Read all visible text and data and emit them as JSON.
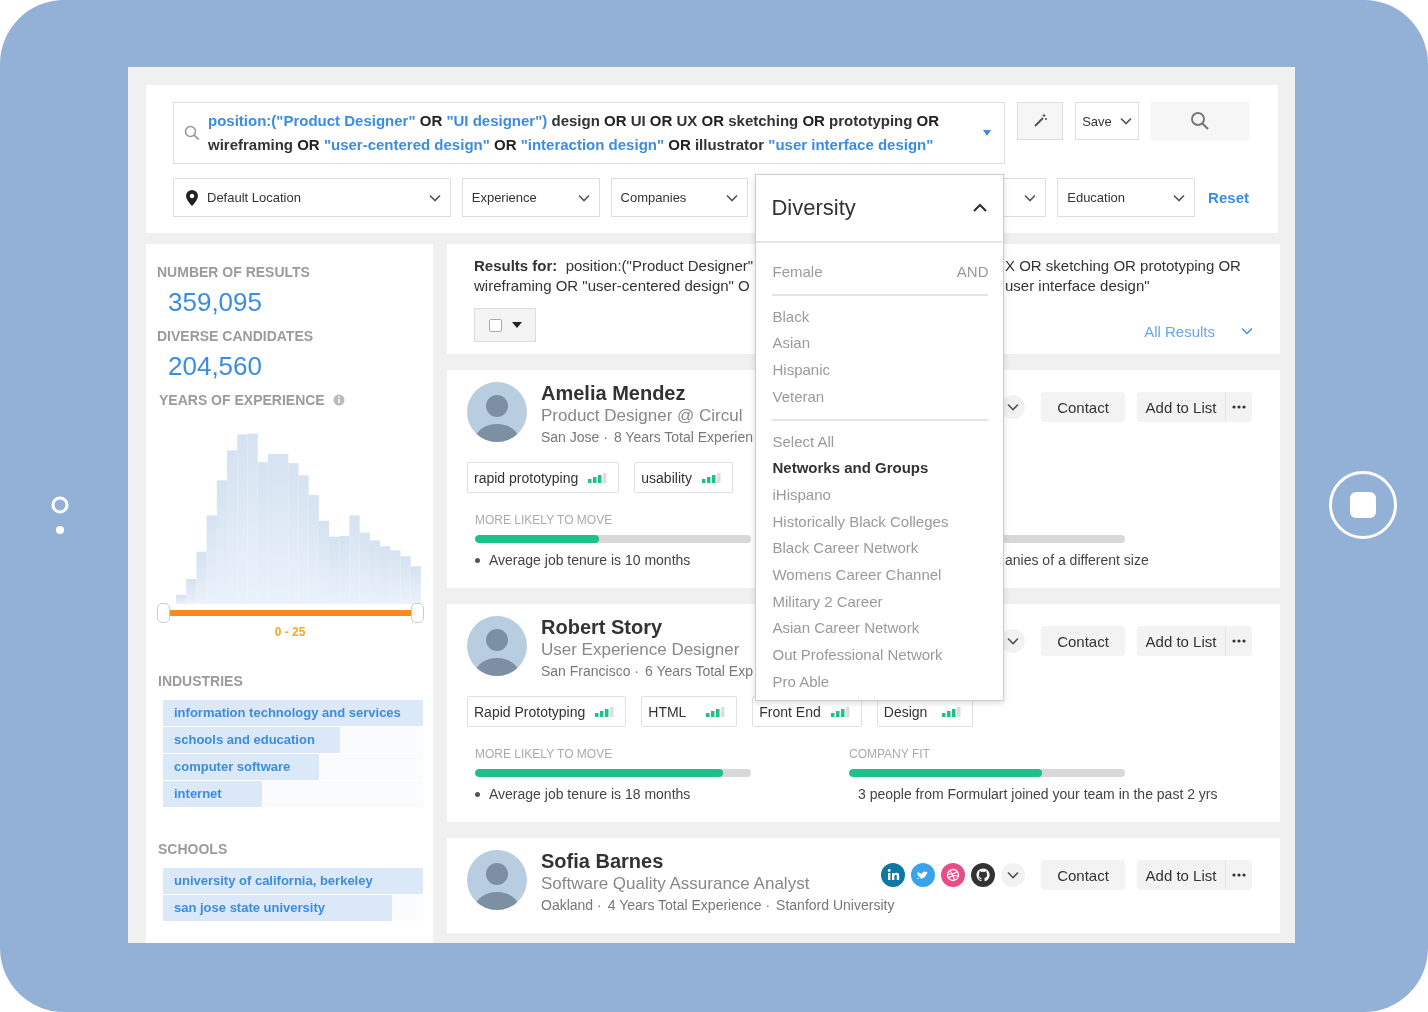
{
  "query": {
    "segments": [
      {
        "kind": "phrase",
        "text": "position:(\"Product Designer\""
      },
      {
        "kind": "op",
        "text": "OR"
      },
      {
        "kind": "phrase",
        "text": "\"UI designer\")"
      },
      {
        "kind": "word",
        "text": "design"
      },
      {
        "kind": "op",
        "text": "OR"
      },
      {
        "kind": "word",
        "text": "UI"
      },
      {
        "kind": "op",
        "text": "OR"
      },
      {
        "kind": "word",
        "text": "UX"
      },
      {
        "kind": "op",
        "text": "OR"
      },
      {
        "kind": "word",
        "text": "sketching"
      },
      {
        "kind": "op",
        "text": "OR"
      },
      {
        "kind": "word",
        "text": "prototyping"
      },
      {
        "kind": "op",
        "text": "OR"
      },
      {
        "kind": "word",
        "text": "wireframing"
      },
      {
        "kind": "op",
        "text": "OR"
      },
      {
        "kind": "phrase",
        "text": "\"user-centered design\""
      },
      {
        "kind": "op",
        "text": "OR"
      },
      {
        "kind": "phrase",
        "text": "\"interaction design\""
      },
      {
        "kind": "op",
        "text": "OR"
      },
      {
        "kind": "word",
        "text": "illustrator"
      },
      {
        "kind": "phrase",
        "text": "\"user interface design\""
      }
    ]
  },
  "save_button": "Save",
  "filters": [
    {
      "kind": "location",
      "label": "Default Location",
      "expanded": false
    },
    {
      "kind": "select",
      "label": "Experience",
      "expanded": false
    },
    {
      "kind": "select",
      "label": "Companies",
      "expanded": false
    },
    {
      "kind": "select",
      "label": "Diversity",
      "expanded": true
    },
    {
      "kind": "select",
      "expanded": false
    },
    {
      "kind": "select",
      "label": "Education",
      "expanded": false
    }
  ],
  "reset_link": "Reset",
  "diversity_menu": [
    {
      "kind": "option",
      "label": "Female",
      "suffix": "AND"
    },
    {
      "kind": "divider"
    },
    {
      "kind": "option",
      "label": "Black"
    },
    {
      "kind": "option",
      "label": "Asian"
    },
    {
      "kind": "option",
      "label": "Hispanic"
    },
    {
      "kind": "option",
      "label": "Veteran"
    },
    {
      "kind": "divider"
    },
    {
      "kind": "option",
      "label": "Select All"
    },
    {
      "kind": "heading",
      "label": "Networks and Groups"
    },
    {
      "kind": "option",
      "label": "iHispano"
    },
    {
      "kind": "option",
      "label": "Historically Black Colleges"
    },
    {
      "kind": "option",
      "label": "Black Career Network"
    },
    {
      "kind": "option",
      "label": "Womens Career Channel"
    },
    {
      "kind": "option",
      "label": "Military 2 Career"
    },
    {
      "kind": "option",
      "label": "Asian Career Network"
    },
    {
      "kind": "option",
      "label": "Out Professional Network"
    },
    {
      "kind": "option",
      "label": "Pro Able"
    }
  ],
  "stats": [
    {
      "label": "NUMBER OF RESULTS",
      "value": "359,095"
    },
    {
      "label": "DIVERSE CANDIDATES",
      "value": "204,560"
    }
  ],
  "experience": {
    "label": "YEARS OF EXPERIENCE",
    "level": 1,
    "range": "0 - 25"
  },
  "industries": {
    "title": "INDUSTRIES",
    "items": [
      {
        "label": "information technology and services",
        "level": 1
      },
      {
        "label": "schools and education",
        "level": 0.68
      },
      {
        "label": "computer software",
        "level": 0.6
      },
      {
        "label": "internet",
        "level": 0.38
      }
    ]
  },
  "schools": {
    "title": "SCHOOLS",
    "items": [
      {
        "label": "university of california, berkeley",
        "level": 1
      },
      {
        "label": "san jose state university",
        "level": 0.88
      }
    ]
  },
  "results": {
    "label": "Results for:",
    "checked": false,
    "left_lines": [
      "position:(\"Product Designer\"",
      "wireframing OR \"user-centered design\" O"
    ],
    "right_lines": [
      "X OR sketching OR prototyping OR",
      "user interface design\""
    ],
    "filter": "All Results"
  },
  "candidates": [
    {
      "name": "Amelia Mendez",
      "title": "Product Designer @ Circul",
      "meta": [
        "San Jose ·",
        "8 Years Total Experien"
      ],
      "contact": "Contact",
      "add": "Add to List",
      "skills": [
        "rapid prototyping",
        "usability"
      ],
      "metrics": [
        {
          "label": "MORE LIKELY TO MOVE",
          "level": 0.45,
          "note": "Average job tenure is 10 months"
        },
        {
          "kind": "cut",
          "note": "anies of a different size"
        }
      ]
    },
    {
      "name": "Robert Story",
      "title": "User Experience Designer",
      "meta": [
        "San Francisco ·",
        "6 Years Total Exp"
      ],
      "contact": "Contact",
      "add": "Add to List",
      "skills": [
        "Rapid Prototyping",
        "HTML",
        "Front End",
        "Design"
      ],
      "metrics": [
        {
          "label": "MORE LIKELY TO MOVE",
          "level": 0.9,
          "note": "Average job tenure is 18 months"
        },
        {
          "label": "COMPANY FIT",
          "level": 0.7,
          "note": "3 people from Formulart joined your team in the past 2 yrs"
        }
      ]
    },
    {
      "name": "Sofia Barnes",
      "title": "Software Quality Assurance Analyst",
      "meta": [
        "Oakland ·",
        "4 Years Total Experience ·",
        "Stanford University"
      ],
      "socials": [
        {
          "kind": "linkedin"
        },
        {
          "kind": "twitter"
        },
        {
          "kind": "dribbble"
        },
        {
          "kind": "github"
        }
      ],
      "contact": "Contact",
      "add": "Add to List"
    }
  ]
}
